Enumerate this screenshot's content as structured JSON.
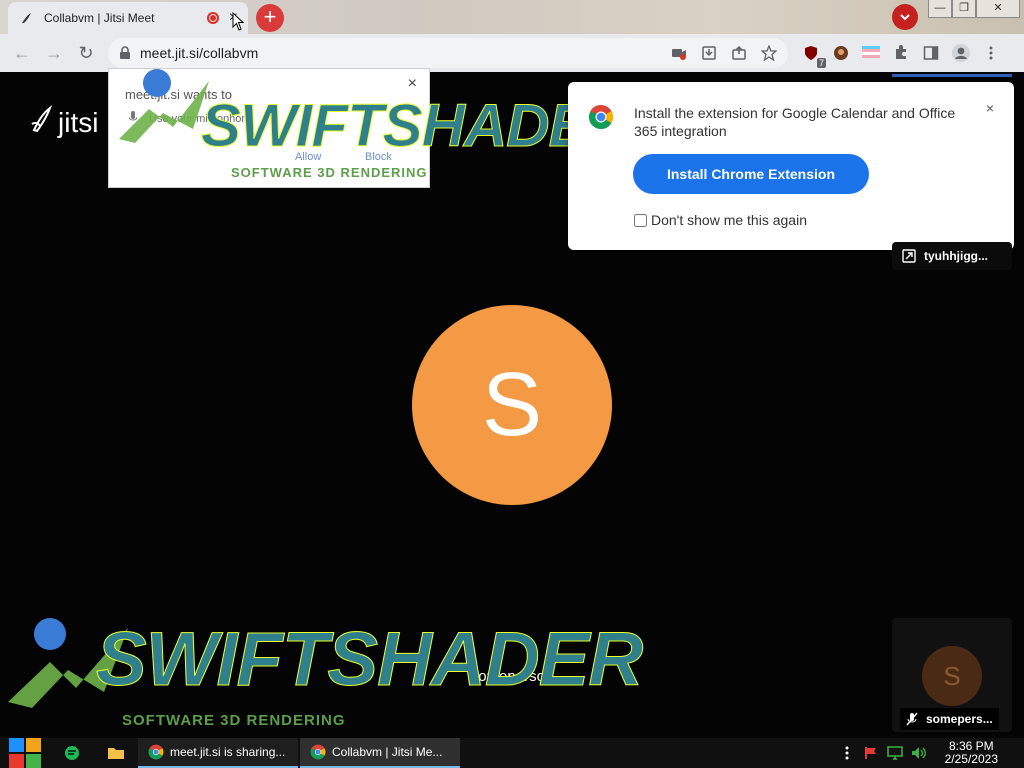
{
  "browser": {
    "tab": {
      "title": "Collabvm | Jitsi Meet",
      "close_icon": "×"
    },
    "new_tab_icon": "+",
    "tab_list_icon": "⌄",
    "window_controls": {
      "minimize": "—",
      "restore": "❐",
      "close": "✕"
    },
    "url": "meet.jit.si/collabvm",
    "nav": {
      "back": "←",
      "forward": "→",
      "reload": "↻"
    },
    "extension_badge": "7"
  },
  "page": {
    "logo_text": "jitsi",
    "permission_prompt": {
      "title": "meet.jit.si wants to",
      "item": "Use your microphone",
      "allow": "Allow",
      "block": "Block",
      "close": "×"
    },
    "watermark": {
      "word": "SWIFTSHADER",
      "subtitle": "SOFTWARE 3D RENDERING"
    },
    "extension_popup": {
      "message": "Install the extension for Google Calendar and Office 365 integration",
      "install_button": "Install Chrome Extension",
      "dont_show": "Don't show me this again",
      "close": "×"
    },
    "share_chip_name": "tyuhhjigg...",
    "main_avatar_letter": "S",
    "main_participant_name": "someperson",
    "tile": {
      "avatar_letter": "S",
      "name": "somepers..."
    }
  },
  "taskbar": {
    "tasks": [
      {
        "label": "meet.jit.si is sharing..."
      },
      {
        "label": "Collabvm | Jitsi Me..."
      }
    ],
    "clock": {
      "time": "8:36 PM",
      "date": "2/25/2023"
    }
  },
  "colors": {
    "accent_blue": "#1a73e8",
    "avatar_orange": "#f49a45",
    "record_red": "#d93025"
  }
}
